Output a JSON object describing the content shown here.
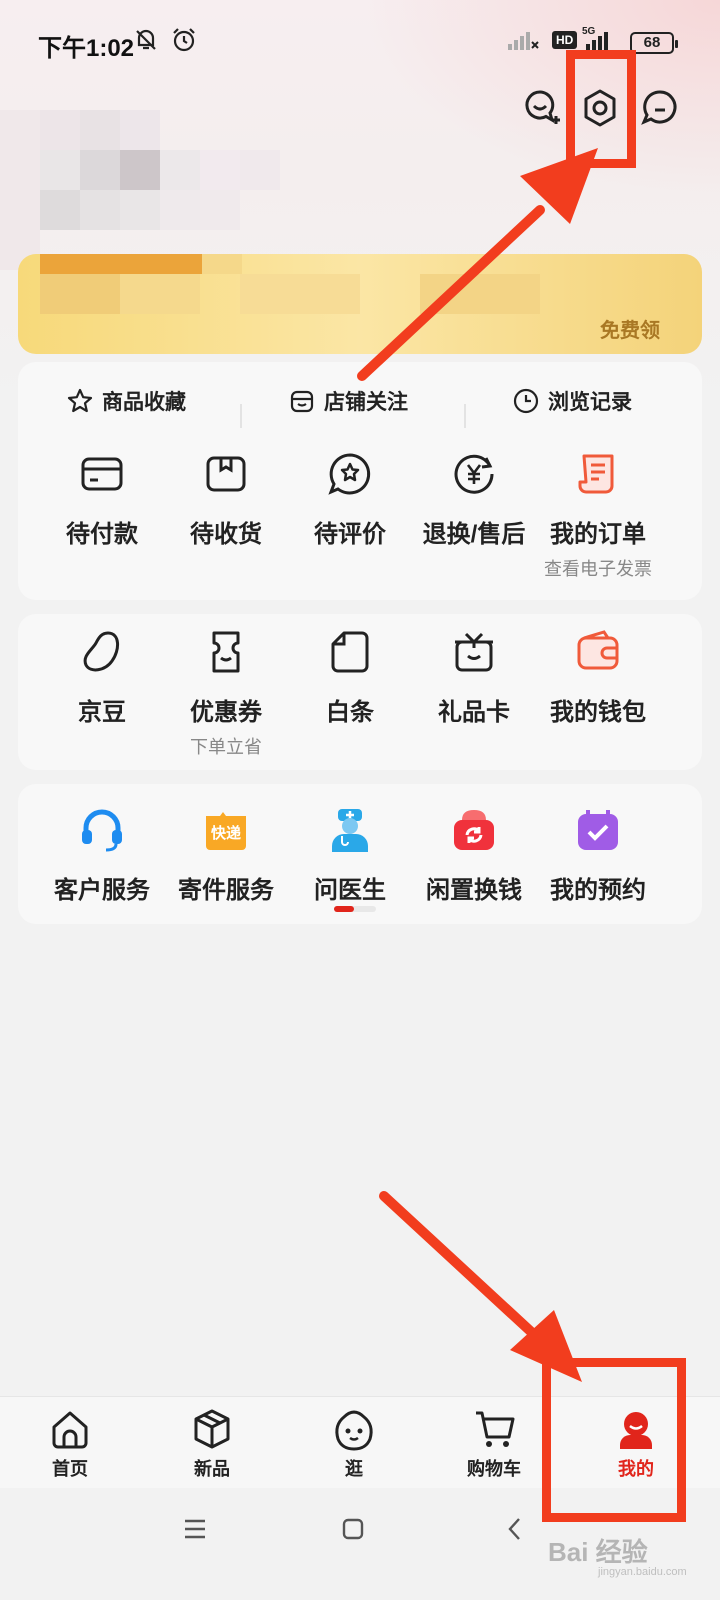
{
  "status_bar": {
    "time": "下午1:02",
    "hd": "HD",
    "network": "5G",
    "battery": "68",
    "icons": [
      "mute-bell-icon",
      "alarm-icon",
      "no-signal-icon",
      "signal-icon",
      "battery-icon"
    ]
  },
  "header": {
    "icons": [
      "add-friend-icon",
      "settings-icon",
      "message-icon"
    ]
  },
  "profile": {
    "vip_action": "免费领"
  },
  "quick_links": [
    {
      "label": "商品收藏",
      "icon": "star-icon"
    },
    {
      "label": "店铺关注",
      "icon": "store-icon"
    },
    {
      "label": "浏览记录",
      "icon": "clock-icon"
    }
  ],
  "orders": [
    {
      "label": "待付款",
      "icon": "card-icon"
    },
    {
      "label": "待收货",
      "icon": "package-icon"
    },
    {
      "label": "待评价",
      "icon": "review-icon"
    },
    {
      "label": "退换/售后",
      "icon": "refund-icon"
    },
    {
      "label": "我的订单",
      "sub": "查看电子发票",
      "icon": "receipt-icon"
    }
  ],
  "assets": [
    {
      "label": "京豆",
      "icon": "bean-icon"
    },
    {
      "label": "优惠券",
      "sub": "下单立省",
      "icon": "coupon-icon"
    },
    {
      "label": "白条",
      "icon": "baitiao-icon"
    },
    {
      "label": "礼品卡",
      "icon": "gift-card-icon"
    },
    {
      "label": "我的钱包",
      "icon": "wallet-icon"
    }
  ],
  "services": [
    {
      "label": "客户服务",
      "icon": "headset-icon"
    },
    {
      "label": "寄件服务",
      "badge": "快递",
      "icon": "express-icon"
    },
    {
      "label": "问医生",
      "icon": "doctor-icon"
    },
    {
      "label": "闲置换钱",
      "icon": "recycle-icon"
    },
    {
      "label": "我的预约",
      "icon": "calendar-check-icon"
    }
  ],
  "bottom_nav": [
    {
      "label": "首页",
      "icon": "home-icon"
    },
    {
      "label": "新品",
      "icon": "cube-icon"
    },
    {
      "label": "逛",
      "icon": "face-icon"
    },
    {
      "label": "购物车",
      "icon": "cart-icon"
    },
    {
      "label": "我的",
      "icon": "profile-icon",
      "active": true
    }
  ],
  "watermark": {
    "text": "Bai 经验",
    "sub": "jingyan.baidu.com"
  },
  "colors": {
    "brand": "#e1251b",
    "annotation": "#f23d1e",
    "vip_gold": "#f7d97a"
  }
}
